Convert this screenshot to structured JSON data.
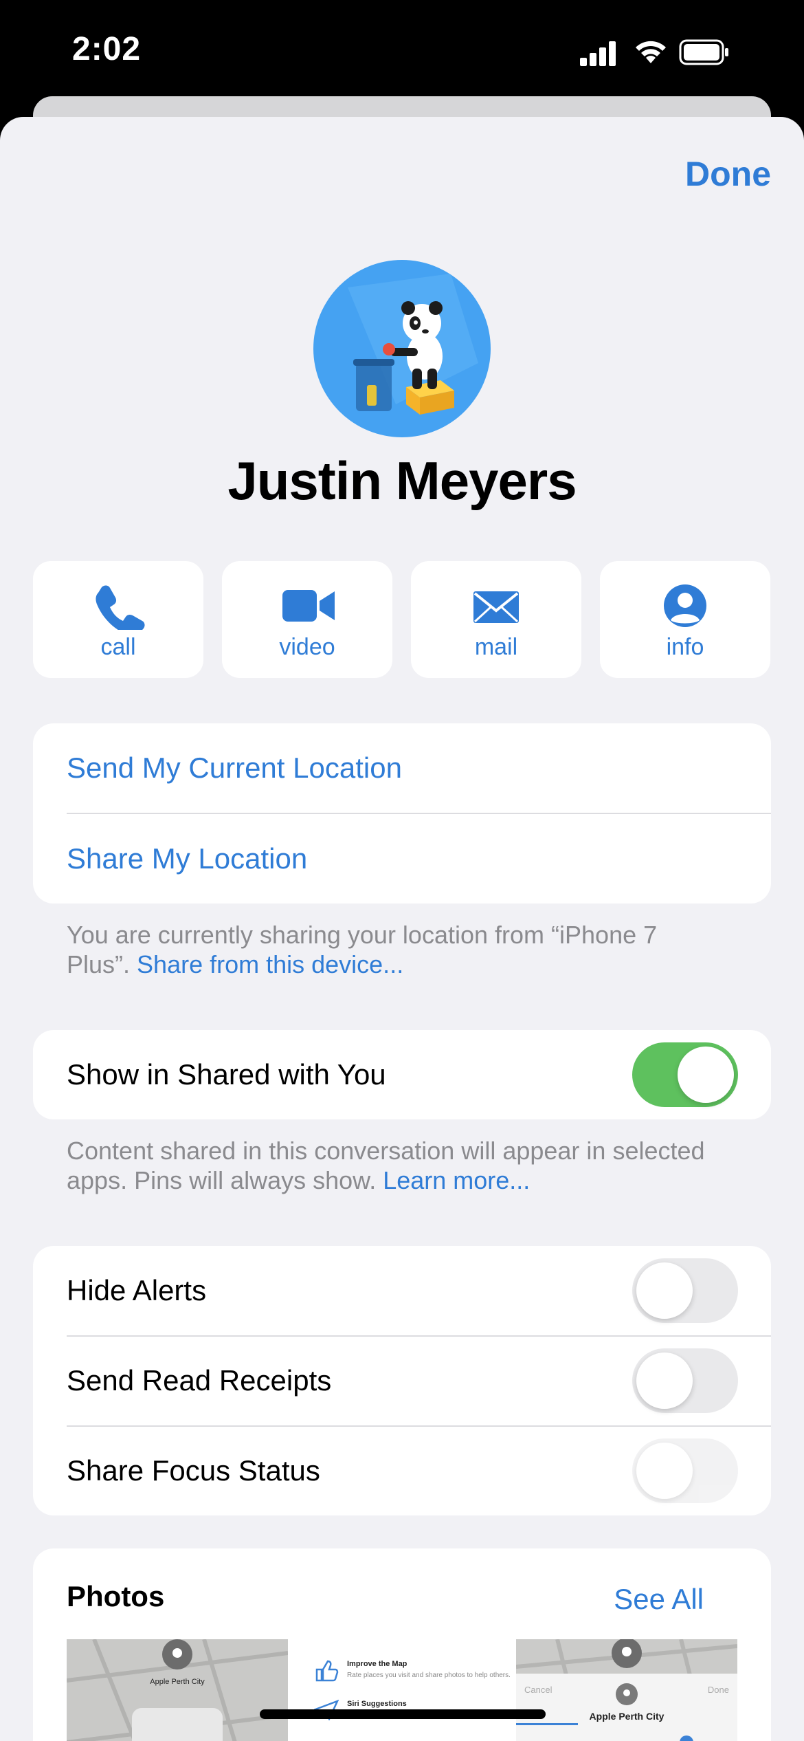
{
  "status_bar": {
    "time": "2:02"
  },
  "header": {
    "done_label": "Done"
  },
  "contact": {
    "name": "Justin Meyers"
  },
  "actions": [
    {
      "label": "call",
      "icon": "phone-icon"
    },
    {
      "label": "video",
      "icon": "video-camera-icon"
    },
    {
      "label": "mail",
      "icon": "envelope-icon"
    },
    {
      "label": "info",
      "icon": "person-circle-icon"
    }
  ],
  "location": {
    "send_current": "Send My Current Location",
    "share": "Share My Location",
    "footnote_text": "You are currently sharing your location from “iPhone 7 Plus”. ",
    "footnote_link": "Share from this device..."
  },
  "shared_with_you": {
    "label": "Show in Shared with You",
    "enabled": true,
    "footnote_text": "Content shared in this conversation will appear in selected apps. Pins will always show. ",
    "footnote_link": "Learn more..."
  },
  "settings": [
    {
      "label": "Hide Alerts",
      "enabled": false
    },
    {
      "label": "Send Read Receipts",
      "enabled": false
    },
    {
      "label": "Share Focus Status",
      "enabled": false,
      "disabled": true
    }
  ],
  "photos": {
    "title": "Photos",
    "see_all": "See All",
    "thumb_texts": {
      "map_pin_label": "Apple Perth City",
      "improve_map": "Improve the Map",
      "improve_map_sub": "Rate places you visit and share photos to help others.",
      "siri_suggestions": "Siri Suggestions",
      "cancel": "Cancel",
      "done": "Done",
      "place": "Apple Perth City"
    }
  },
  "colors": {
    "accent": "#2f7cd6",
    "toggle_on": "#5ec15e",
    "background": "#f1f1f5"
  }
}
